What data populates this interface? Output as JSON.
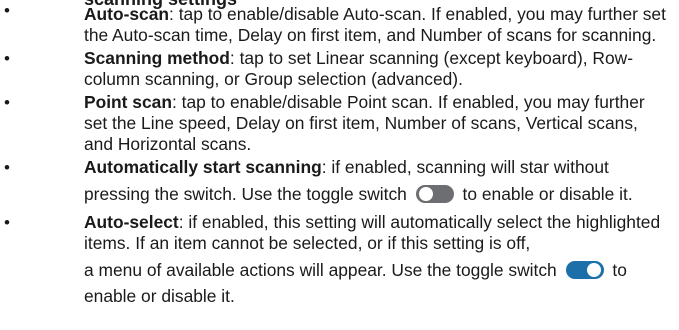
{
  "heading_partial": "scanning settings",
  "bullet_glyph": "•",
  "items": [
    {
      "term": "Auto-scan",
      "text": ": tap to enable/disable Auto-scan. If enabled, you may further set the Auto-scan time, Delay on first item, and Number of scans for scanning."
    },
    {
      "term": "Scanning method",
      "text": ": tap to set Linear scanning (except keyboard), Row-column scanning, or Group selection (advanced)."
    },
    {
      "term": "Point scan",
      "text": ": tap to enable/disable Point scan. If enabled, you may further set the Line speed, Delay on first item, Number of scans, Vertical scans, and Horizontal scans."
    },
    {
      "term": "Automatically start scanning",
      "text_line1": ": if enabled, scanning will star without",
      "text_before_toggle": "pressing the switch. Use the toggle switch",
      "toggle_state": "off",
      "text_after_toggle": "to enable or disable it."
    },
    {
      "term": "Auto-select",
      "text_main": ": if enabled, this setting will automatically select the highlighted items. If an item cannot be selected, or if this setting is off,",
      "text_before_toggle": "a menu of available actions will appear. Use the toggle switch",
      "toggle_state": "on",
      "text_after_toggle": "to",
      "text_end": "enable or disable it."
    }
  ],
  "colors": {
    "text": "#1a1a1a",
    "toggle_off": "#6d6e71",
    "toggle_on": "#1c6fa8"
  }
}
